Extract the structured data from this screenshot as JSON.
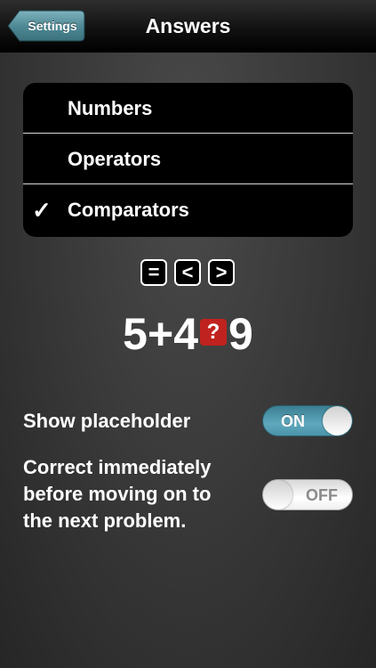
{
  "navbar": {
    "back_label": "Settings",
    "title": "Answers"
  },
  "answer_types": {
    "items": [
      {
        "label": "Numbers",
        "checked": false
      },
      {
        "label": "Operators",
        "checked": false
      },
      {
        "label": "Comparators",
        "checked": true
      }
    ],
    "check_mark": "✓"
  },
  "comparator_symbols": [
    "=",
    "<",
    ">"
  ],
  "example": {
    "left": "5",
    "operator": "+",
    "middle": "4",
    "placeholder": "?",
    "right": "9"
  },
  "settings": {
    "show_placeholder": {
      "label": "Show placeholder",
      "state_label": "ON",
      "on": true
    },
    "correct_immediately": {
      "label_lines": [
        "Correct immediately",
        "before moving on to",
        "the next problem."
      ],
      "state_label": "OFF",
      "on": false
    }
  },
  "colors": {
    "placeholder_red": "#c0231f",
    "toggle_on_blue": "#5fa8bd",
    "back_button_teal": "#4f8a96"
  }
}
